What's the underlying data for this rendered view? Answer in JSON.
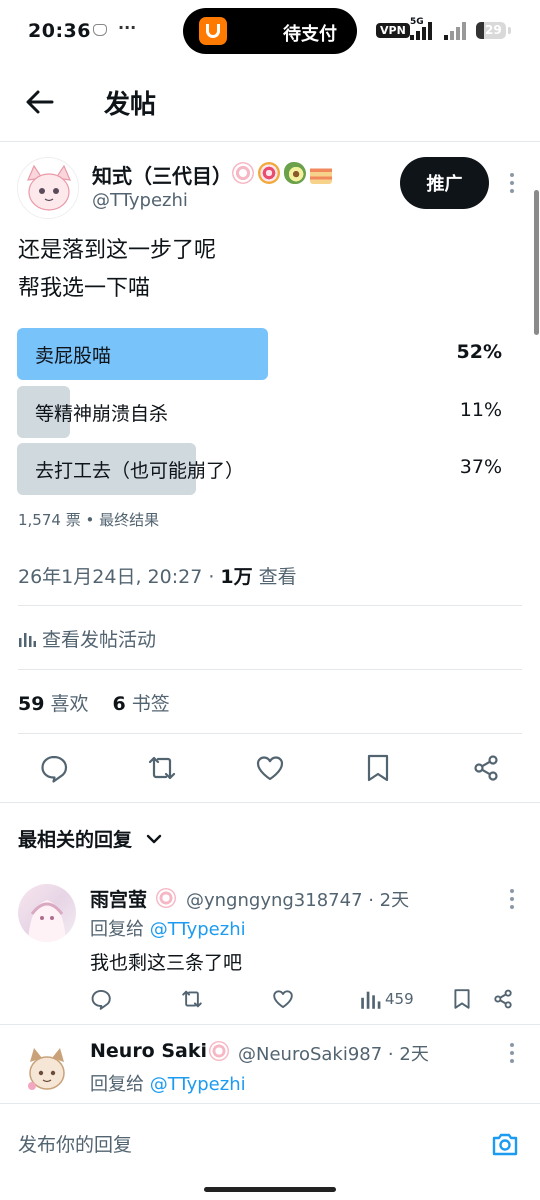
{
  "status_bar": {
    "time": "20:36",
    "dots": "···",
    "pill_text": "待支付",
    "vpn": "VPN",
    "net": "5G",
    "battery": "29"
  },
  "header": {
    "title": "发帖"
  },
  "post": {
    "author_name": "知式（三代目）",
    "author_handle": "@TTypezhi",
    "promote_label": "推广",
    "text_lines": [
      "还是落到这一步了呢",
      "帮我选一下喵"
    ],
    "poll": {
      "options": [
        {
          "label": "卖屁股喵",
          "percent_text": "52%",
          "percent": 52,
          "winner": true
        },
        {
          "label": "等精神崩溃自杀",
          "percent_text": "11%",
          "percent": 11,
          "winner": false
        },
        {
          "label": "去打工去（也可能崩了）",
          "percent_text": "37%",
          "percent": 37,
          "winner": false
        }
      ],
      "votes": "1,574 票",
      "sep": " • ",
      "status": "最终结果",
      "winner_color": "#79c3fb",
      "other_color": "#cfd9de"
    },
    "timestamp": "26年1月24日, 20:27 · ",
    "views_count": "1万",
    "views_label": " 查看",
    "activity_label": "查看发帖活动",
    "likes_count": "59",
    "likes_label": "喜欢",
    "bookmarks_count": "6",
    "bookmarks_label": "书签"
  },
  "replies_section": {
    "title": "最相关的回复"
  },
  "replies": [
    {
      "name": "雨宫萤",
      "meta": "@yngngyng318747 · 2天",
      "reply_to_prefix": "回复给 ",
      "reply_to_handle": "@TTypezhi",
      "text": "我也剩这三条了吧",
      "views": "459"
    },
    {
      "name": "Neuro Saki",
      "meta": "@NeuroSaki987 · 2天",
      "reply_to_prefix": "回复给 ",
      "reply_to_handle": "@TTypezhi"
    }
  ],
  "compose": {
    "placeholder": "发布你的回复"
  },
  "colors": {
    "accent": "#1d9bf0",
    "text": "#0f1419",
    "muted": "#536471"
  }
}
